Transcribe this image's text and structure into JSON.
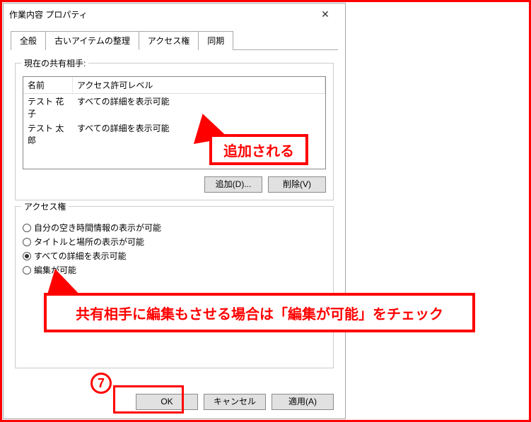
{
  "window": {
    "title": "作業内容 プロパティ",
    "close_glyph": "✕"
  },
  "tabs": {
    "general": "全般",
    "autoarchive": "古いアイテムの整理",
    "permissions": "アクセス権",
    "sync": "同期"
  },
  "share_group": {
    "legend": "現在の共有相手:",
    "col_name": "名前",
    "col_level": "アクセス許可レベル",
    "rows": [
      {
        "name": "テスト 花子",
        "level": "すべての詳細を表示可能"
      },
      {
        "name": "テスト 太郎",
        "level": "すべての詳細を表示可能"
      }
    ],
    "add_btn": "追加(D)...",
    "remove_btn": "削除(V)"
  },
  "perm_group": {
    "legend": "アクセス権",
    "opt_freebusy": "自分の空き時間情報の表示が可能",
    "opt_subject": "タイトルと場所の表示が可能",
    "opt_full": "すべての詳細を表示可能",
    "opt_edit": "編集が可能"
  },
  "dialog_buttons": {
    "ok": "OK",
    "cancel": "キャンセル",
    "apply": "適用(A)"
  },
  "callouts": {
    "added": "追加される",
    "edit_note": "共有相手に編集もさせる場合は「編集が可能」をチェック",
    "step_num": "7"
  }
}
